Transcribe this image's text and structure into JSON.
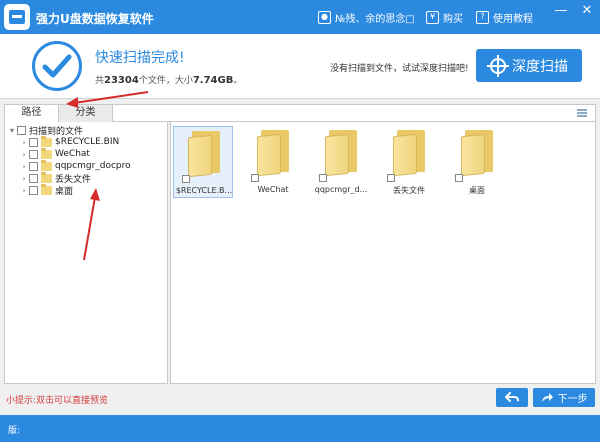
{
  "app": {
    "title": "强力U盘数据恢复软件",
    "icon": "usb-drive-icon"
  },
  "titlebar": {
    "user": {
      "label": "№残、余的思念□",
      "icon": "user-icon"
    },
    "buy": {
      "label": "购买",
      "icon": "yen-icon"
    },
    "help": {
      "label": "使用教程",
      "icon": "book-icon"
    },
    "minimize": "—",
    "close": "✕"
  },
  "header": {
    "status_title": "快速扫描完成!",
    "summary_prefix": "共",
    "file_count": "23304",
    "summary_middle": "个文件，大小",
    "total_size": "7.74GB",
    "summary_suffix": "。",
    "deep_hint": "没有扫描到文件，试试深度扫描吧!",
    "deep_button": "深度扫描"
  },
  "tabs": [
    {
      "label": "路径",
      "active": true
    },
    {
      "label": "分类",
      "active": false
    }
  ],
  "tree": {
    "root": "扫描到的文件",
    "children": [
      "$RECYCLE.BIN",
      "WeChat",
      "qqpcmgr_docpro",
      "丢失文件",
      "桌面"
    ]
  },
  "files": [
    {
      "name": "$RECYCLE.B...",
      "selected": true
    },
    {
      "name": "WeChat",
      "selected": false
    },
    {
      "name": "qqpcmgr_d...",
      "selected": false
    },
    {
      "name": "丢失文件",
      "selected": false
    },
    {
      "name": "桌面",
      "selected": false
    }
  ],
  "footer": {
    "tip": "小提示:双击可以直接预览",
    "next_label": "下一步",
    "version": "版:"
  },
  "colors": {
    "accent": "#2b8ae0",
    "tip": "#d23c3c",
    "annotation": "#d62b2b",
    "folder": "#f3d77c"
  }
}
